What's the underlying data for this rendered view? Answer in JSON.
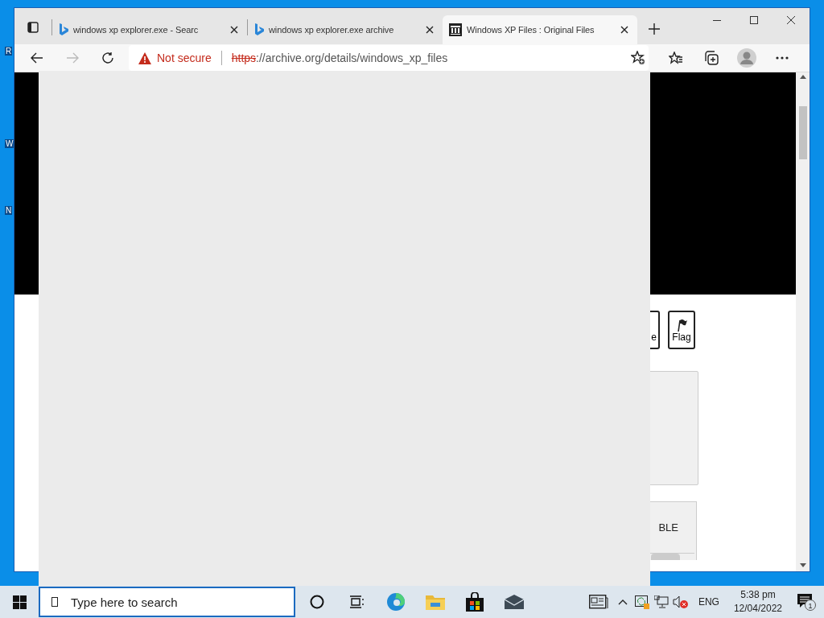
{
  "desktop_labels": [
    "R",
    "W",
    "N"
  ],
  "browser": {
    "tabs": [
      {
        "title": "windows xp explorer.exe - Searc",
        "kind": "bing",
        "selected": false
      },
      {
        "title": "windows xp explorer.exe archive",
        "kind": "bing",
        "selected": false
      },
      {
        "title": "Windows XP Files : Original Files",
        "kind": "archive",
        "selected": true
      }
    ],
    "security": "Not secure",
    "url_scheme": "https",
    "url_rest": "://archive.org/details/windows_xp_files"
  },
  "page": {
    "buttons": [
      {
        "label": "e",
        "kind": "plain"
      },
      {
        "label": "Flag",
        "kind": "flag"
      }
    ],
    "card_text": "BLE"
  },
  "taskbar": {
    "search_placeholder": "Type here to search",
    "language": "ENG",
    "clock_time": "5:38 pm",
    "clock_date": "12/04/2022",
    "notification_count": "1"
  }
}
